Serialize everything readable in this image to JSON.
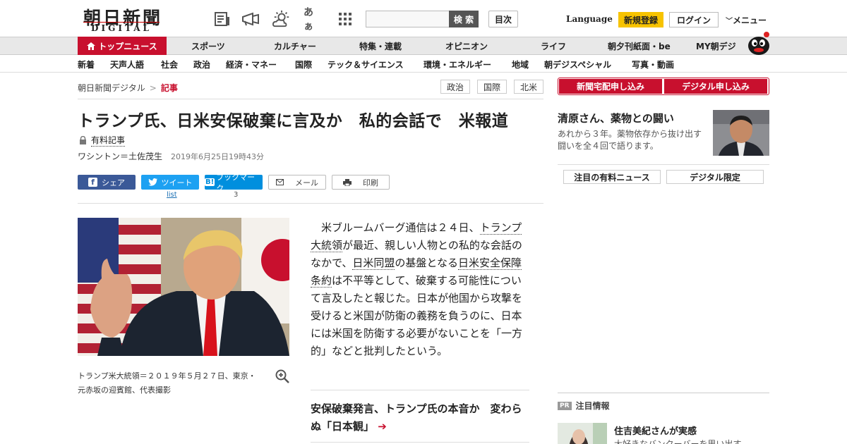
{
  "header": {
    "logo_jp": "朝日新聞",
    "logo_en": "DIGITAL",
    "font_icon_label": "あぁ",
    "search_button": "検 索",
    "toc_button": "目次",
    "language": "Language",
    "register": "新規登録",
    "login": "ログイン",
    "menu": "メニュー"
  },
  "nav_main": {
    "home": "トップニュース",
    "items": [
      "スポーツ",
      "カルチャー",
      "特集・連載",
      "オピニオン",
      "ライフ",
      "朝夕刊紙面・be",
      "MY朝デジ"
    ]
  },
  "nav_sub": {
    "items": [
      "新着",
      "天声人語",
      "社会",
      "政治",
      "経済・マネー",
      "国際",
      "テック＆サイエンス",
      "環境・エネルギー",
      "地域",
      "朝デジスペシャル",
      "写真・動画"
    ]
  },
  "breadcrumb": {
    "root": "朝日新聞デジタル",
    "sep": ">",
    "current": "記事"
  },
  "tags": [
    "政治",
    "国際",
    "北米"
  ],
  "article": {
    "title": "トランプ氏、日米安保破棄に言及か　私的会話で　米報道",
    "paid_label": "有料記事",
    "author": "ワシントン＝土佐茂生",
    "datetime": "2019年6月25日19時43分",
    "photo_caption": "トランプ米大統領＝２０１９年５月２７日、東京・元赤坂の迎賓館、代表撮影",
    "body_parts": [
      "米ブルームバーグ通信は２４日、",
      "トランプ大統領",
      "が最近、親しい人物との私的な会話のなかで、",
      "日米同盟",
      "の基盤となる",
      "日米安全保障条約",
      "は不平等として、破棄する可能性について言及したと報じた。日本が他国から攻撃を受けると米国が防衛の義務を負うのに、日本には米国を防衛する必要がないことを「一方的」などと批判したという。"
    ],
    "related_title": "安保破棄発言、トランプ氏の本音か　変わらぬ「日本観」",
    "related_arrow": "➔"
  },
  "share": {
    "facebook": "シェア",
    "twitter": "ツイート",
    "twitter_count": "list",
    "hatena": "ブックマーク",
    "hatena_count": "3",
    "mail": "メール",
    "print": "印刷"
  },
  "sidebar": {
    "subscribe_paper": "新聞宅配申し込み",
    "subscribe_digital": "デジタル申し込み",
    "feature_title": "清原さん、薬物との闘い",
    "feature_text": "あれから３年。薬物依存から抜け出す闘いを全４回で語ります。",
    "tab_paid": "注目の有料ニュース",
    "tab_digital": "デジタル限定",
    "pr_badge": "PR",
    "pr_heading": "注目情報",
    "pr_title": "住吉美紀さんが実感",
    "pr_text": "大好きなバンクーバーを思い出す"
  },
  "colors": {
    "brand_red": "#c8102e",
    "register_yellow": "#f7c300",
    "facebook": "#3b5998",
    "twitter": "#1da1f2",
    "hatena": "#008fde"
  }
}
